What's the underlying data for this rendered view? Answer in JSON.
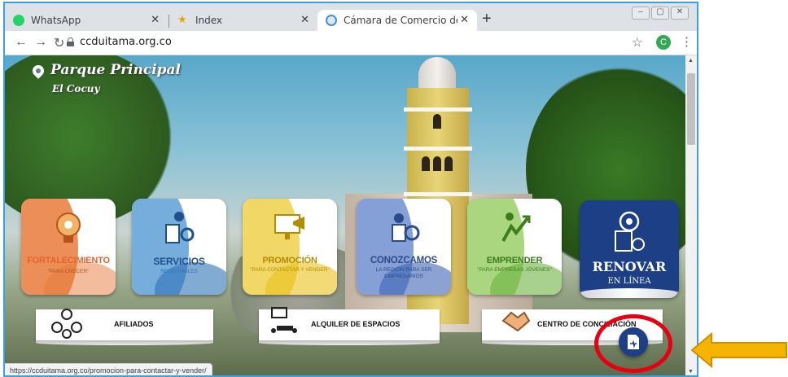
{
  "browser": {
    "tabs": [
      {
        "title": "WhatsApp",
        "icon": "whatsapp-icon",
        "active": false
      },
      {
        "title": "Index",
        "icon": "star-logo-icon",
        "active": false
      },
      {
        "title": "Cámara de Comercio de Duitama",
        "icon": "ccd-logo-icon",
        "active": true
      }
    ],
    "new_tab": "+",
    "url": "ccduitama.org.co",
    "profile_initial": "C",
    "status_url": "https://ccduitama.org.co/promocion-para-contactar-y-vender/"
  },
  "hero": {
    "location_title": "Parque Principal",
    "location_subtitle": "El Cocuy"
  },
  "cards": [
    {
      "label": "FORTALECIMIENTO",
      "sub": "\"PARA CRECER\"",
      "color": "#e87a3a",
      "icon": "gears-lightbulb-icon"
    },
    {
      "label": "SERVICIOS",
      "sub": "REGISTRALES",
      "color": "#2f73b8",
      "icon": "registry-services-icon"
    },
    {
      "label": "PROMOCIÓN",
      "sub": "\"PARA CONTACTAR Y VENDER\"",
      "color": "#e9c21b",
      "icon": "promotion-monitor-icon"
    },
    {
      "label": "CONOZCAMOS",
      "sub": "LA REGIÓN PARA SER EMPRESARIOS",
      "color": "#3f64b4",
      "icon": "region-analytics-icon"
    },
    {
      "label": "EMPRENDER",
      "sub": "\"PARA EMPRESAS JÓVENES\"",
      "color": "#6db33f",
      "icon": "entrepreneur-growth-icon"
    }
  ],
  "renovar": {
    "label": "RENOVAR",
    "sub": "EN LÍNEA",
    "icon": "renew-online-icon"
  },
  "bottom_buttons": [
    {
      "label": "AFILIADOS",
      "icon": "affiliates-network-icon"
    },
    {
      "label": "ALQUILER DE ESPACIOS",
      "icon": "meeting-room-icon"
    },
    {
      "label": "CENTRO DE CONCILIACIÓN",
      "icon": "handshake-icon"
    }
  ],
  "colors": {
    "accent": "#1d3f85",
    "highlight": "#e60012",
    "arrow": "#f5b400"
  }
}
